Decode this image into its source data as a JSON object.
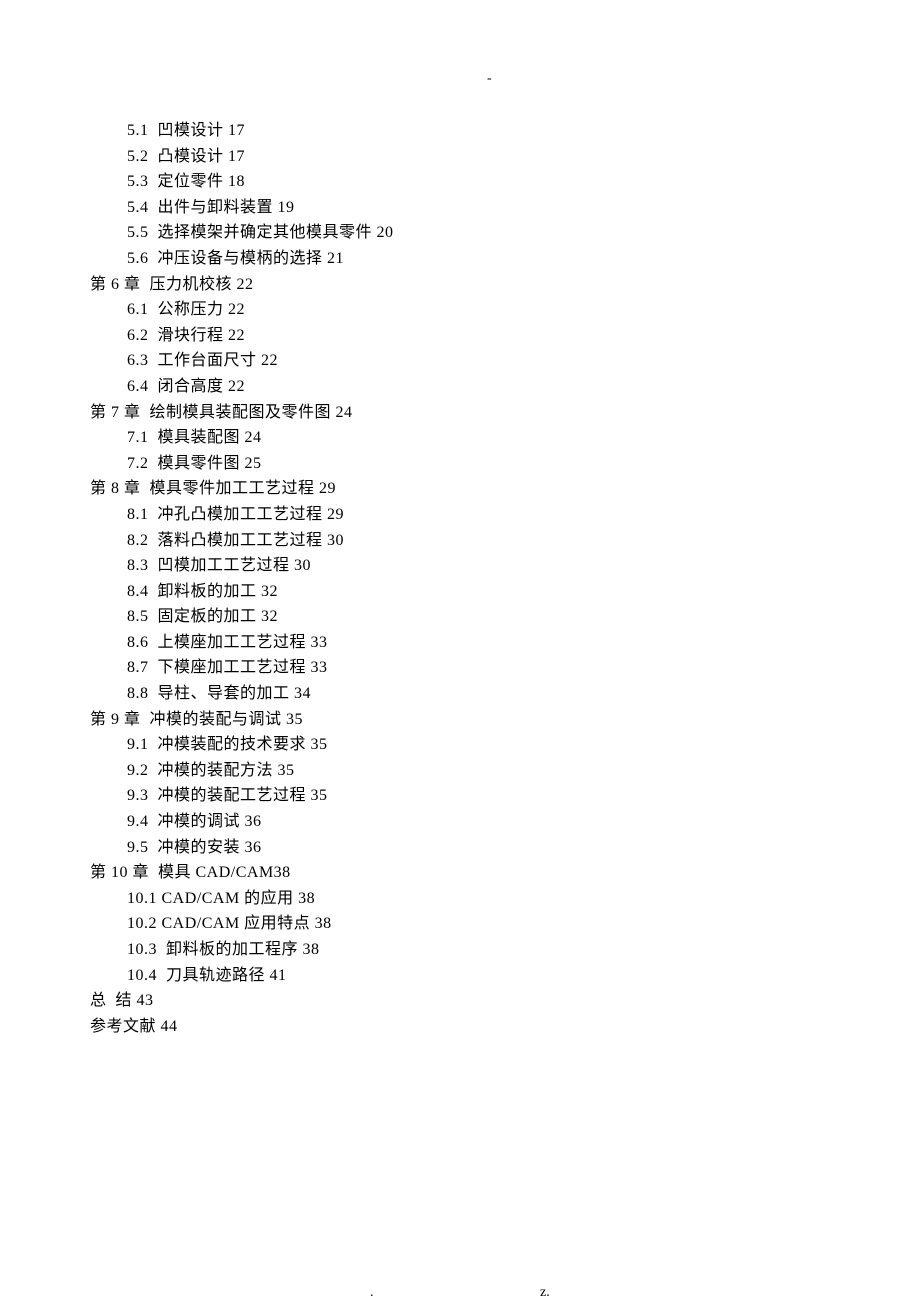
{
  "marker_top": "-",
  "footer_left": ".",
  "footer_right": "z.",
  "lines": [
    {
      "indent": 2,
      "text": "5.1  凹模设计 17"
    },
    {
      "indent": 2,
      "text": "5.2  凸模设计 17"
    },
    {
      "indent": 2,
      "text": "5.3  定位零件 18"
    },
    {
      "indent": 2,
      "text": "5.4  出件与卸料装置 19"
    },
    {
      "indent": 2,
      "text": "5.5  选择模架并确定其他模具零件 20"
    },
    {
      "indent": 2,
      "text": "5.6  冲压设备与模柄的选择 21"
    },
    {
      "indent": 1,
      "text": "第 6 章  压力机校核 22"
    },
    {
      "indent": 2,
      "text": "6.1  公称压力 22"
    },
    {
      "indent": 2,
      "text": "6.2  滑块行程 22"
    },
    {
      "indent": 2,
      "text": "6.3  工作台面尺寸 22"
    },
    {
      "indent": 2,
      "text": "6.4  闭合高度 22"
    },
    {
      "indent": 1,
      "text": "第 7 章  绘制模具装配图及零件图 24"
    },
    {
      "indent": 2,
      "text": "7.1  模具装配图 24"
    },
    {
      "indent": 2,
      "text": "7.2  模具零件图 25"
    },
    {
      "indent": 1,
      "text": "第 8 章  模具零件加工工艺过程 29"
    },
    {
      "indent": 2,
      "text": "8.1  冲孔凸模加工工艺过程 29"
    },
    {
      "indent": 2,
      "text": "8.2  落料凸模加工工艺过程 30"
    },
    {
      "indent": 2,
      "text": "8.3  凹模加工工艺过程 30"
    },
    {
      "indent": 2,
      "text": "8.4  卸料板的加工 32"
    },
    {
      "indent": 2,
      "text": "8.5  固定板的加工 32"
    },
    {
      "indent": 2,
      "text": "8.6  上模座加工工艺过程 33"
    },
    {
      "indent": 2,
      "text": "8.7  下模座加工工艺过程 33"
    },
    {
      "indent": 2,
      "text": "8.8  导柱、导套的加工 34"
    },
    {
      "indent": 1,
      "text": "第 9 章  冲模的装配与调试 35"
    },
    {
      "indent": 2,
      "text": "9.1  冲模装配的技术要求 35"
    },
    {
      "indent": 2,
      "text": "9.2  冲模的装配方法 35"
    },
    {
      "indent": 2,
      "text": "9.3  冲模的装配工艺过程 35"
    },
    {
      "indent": 2,
      "text": "9.4  冲模的调试 36"
    },
    {
      "indent": 2,
      "text": "9.5  冲模的安装 36"
    },
    {
      "indent": 1,
      "text": "第 10 章  模具 CAD/CAM38"
    },
    {
      "indent": 2,
      "text": "10.1 CAD/CAM 的应用 38"
    },
    {
      "indent": 2,
      "text": "10.2 CAD/CAM 应用特点 38"
    },
    {
      "indent": 2,
      "text": "10.3  卸料板的加工程序 38"
    },
    {
      "indent": 2,
      "text": "10.4  刀具轨迹路径 41"
    },
    {
      "indent": 1,
      "text": "总  结 43"
    },
    {
      "indent": 1,
      "text": "参考文献 44"
    }
  ]
}
